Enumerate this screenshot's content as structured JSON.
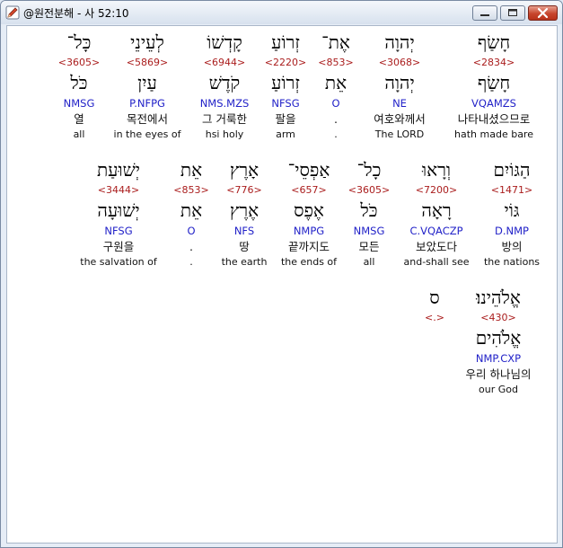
{
  "window": {
    "title": "@원전분해 - 사 52:10",
    "icon": "edit-pen-icon"
  },
  "lines": [
    {
      "words": [
        {
          "hebrew": "כָּל־",
          "strong": "<3605>",
          "lemma": "כֹּל",
          "parse": "NMSG",
          "korean": "열",
          "english": "all"
        },
        {
          "hebrew": "לְעֵינֵי",
          "strong": "<5869>",
          "lemma": "עַיִן",
          "parse": "P.NFPG",
          "korean": "목전에서",
          "english": "in the eyes of"
        },
        {
          "hebrew": "קָדְשׁוֹ",
          "strong": "<6944>",
          "lemma": "קֹדֶשׁ",
          "parse": "NMS.MZS",
          "korean": "그 거룩한",
          "english": "hsi holy"
        },
        {
          "hebrew": "זְרוֹעַ",
          "strong": "<2220>",
          "lemma": "זְרוֹעַ",
          "parse": "NFSG",
          "korean": "팔을",
          "english": "arm"
        },
        {
          "hebrew": "אֶת־",
          "strong": "<853>",
          "lemma": "אֵת",
          "parse": "O",
          "korean": ".",
          "english": "."
        },
        {
          "hebrew": "יְהוָה",
          "strong": "<3068>",
          "lemma": "יְהוָה",
          "parse": "NE",
          "korean": "여호와께서",
          "english": "The LORD"
        },
        {
          "hebrew": "חָשַׂף",
          "strong": "<2834>",
          "lemma": "חָשַׂף",
          "parse": "VQAMZS",
          "korean": "나타내셨으므로",
          "english": "hath made bare",
          "selected": true
        }
      ]
    },
    {
      "words": [
        {
          "hebrew": "יְשׁוּעַת",
          "strong": "<3444>",
          "lemma": "יְשׁוּעָה",
          "parse": "NFSG",
          "korean": "구원을",
          "english": "the salvation of"
        },
        {
          "hebrew": "אֵת",
          "strong": "<853>",
          "lemma": "אֵת",
          "parse": "O",
          "korean": ".",
          "english": "."
        },
        {
          "hebrew": "אָרֶץ",
          "strong": "<776>",
          "lemma": "אֶרֶץ",
          "parse": "NFS",
          "korean": "땅",
          "english": "the earth"
        },
        {
          "hebrew": "אַפְסֵי־",
          "strong": "<657>",
          "lemma": "אֶפֶס",
          "parse": "NMPG",
          "korean": "끝까지도",
          "english": "the ends of"
        },
        {
          "hebrew": "כָל־",
          "strong": "<3605>",
          "lemma": "כֹּל",
          "parse": "NMSG",
          "korean": "모든",
          "english": "all"
        },
        {
          "hebrew": "וְרָאוּ",
          "strong": "<7200>",
          "lemma": "רָאָה",
          "parse": "C.VQACZP",
          "korean": "보았도다",
          "english": "and-shall see"
        },
        {
          "hebrew": "הַגּוֹיִם",
          "strong": "<1471>",
          "lemma": "גּוֹי",
          "parse": "D.NMP",
          "korean": "방의",
          "english": "the nations"
        }
      ]
    },
    {
      "words": [
        {
          "hebrew": "ס",
          "strong": "<.>",
          "lemma": "",
          "parse": "",
          "korean": "",
          "english": ""
        },
        {
          "hebrew": "אֱלֹהֵינוּ׃",
          "strong": "<430>",
          "lemma": "אֱלֹהִים",
          "parse": "NMP.CXP",
          "korean": "우리 하나님의",
          "english": "our God"
        }
      ]
    }
  ]
}
